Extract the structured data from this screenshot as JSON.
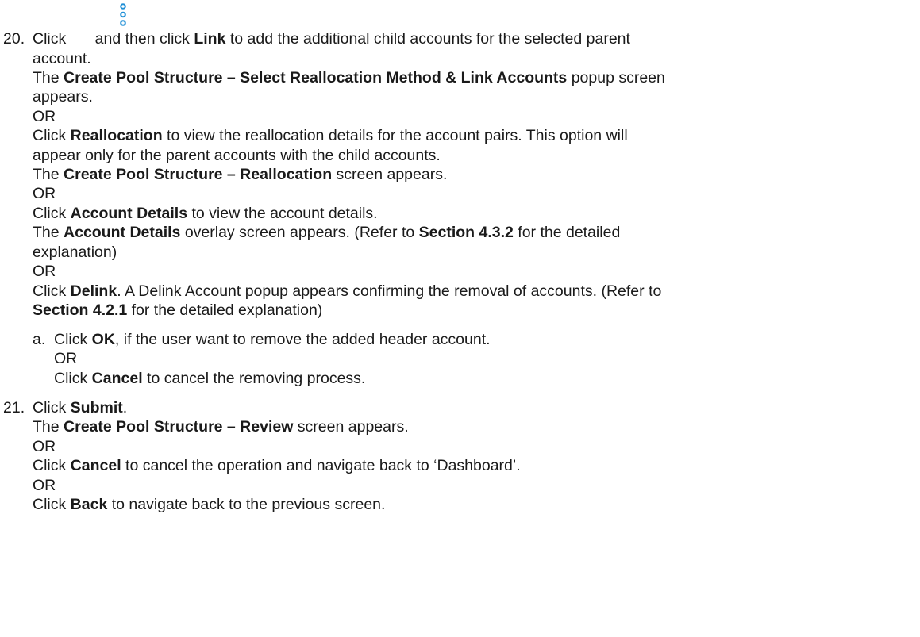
{
  "icon": {
    "name": "more-options-icon",
    "color": "#1f8fd6"
  },
  "step20": {
    "number": "20.",
    "l1": [
      "Click",
      " and then click ",
      "Link",
      " to add the additional child accounts for the selected parent"
    ],
    "l2": "account.",
    "l3": [
      "The ",
      "Create Pool Structure – Select Reallocation Method & Link Accounts",
      " popup screen"
    ],
    "l4": "appears.",
    "or1": "OR",
    "l5": [
      "Click ",
      "Reallocation",
      " to view the reallocation details for the account pairs. This option will"
    ],
    "l6": "appear only for the parent accounts with the child accounts.",
    "l7": [
      "The ",
      "Create Pool Structure – Reallocation",
      " screen appears."
    ],
    "or2": "OR",
    "l8": [
      "Click ",
      "Account Details",
      " to view the account details."
    ],
    "l9": [
      "The ",
      "Account Details",
      " overlay screen appears. (Refer to ",
      "Section 4.3.2",
      " for the detailed"
    ],
    "l10": "explanation)",
    "or3": "OR",
    "l11": [
      "Click ",
      "Delink",
      ". A Delink Account popup appears confirming the removal of accounts. (Refer to"
    ],
    "l12": [
      "Section 4.2.1",
      " for the detailed explanation)"
    ],
    "sub_a": {
      "label": "a.",
      "l1": [
        "Click ",
        "OK",
        ", if the user want to remove the added header account."
      ],
      "or": "OR",
      "l2": [
        "Click ",
        "Cancel",
        " to cancel the removing process."
      ]
    }
  },
  "step21": {
    "number": "21.",
    "l1": [
      "Click ",
      "Submit",
      "."
    ],
    "l2": [
      "The ",
      "Create Pool Structure – Review",
      " screen appears."
    ],
    "or1": "OR",
    "l3": [
      "Click ",
      "Cancel",
      " to cancel the operation and navigate back to ‘Dashboard’."
    ],
    "or2": "OR",
    "l4": [
      "Click ",
      "Back",
      " to navigate back to the previous screen."
    ]
  }
}
